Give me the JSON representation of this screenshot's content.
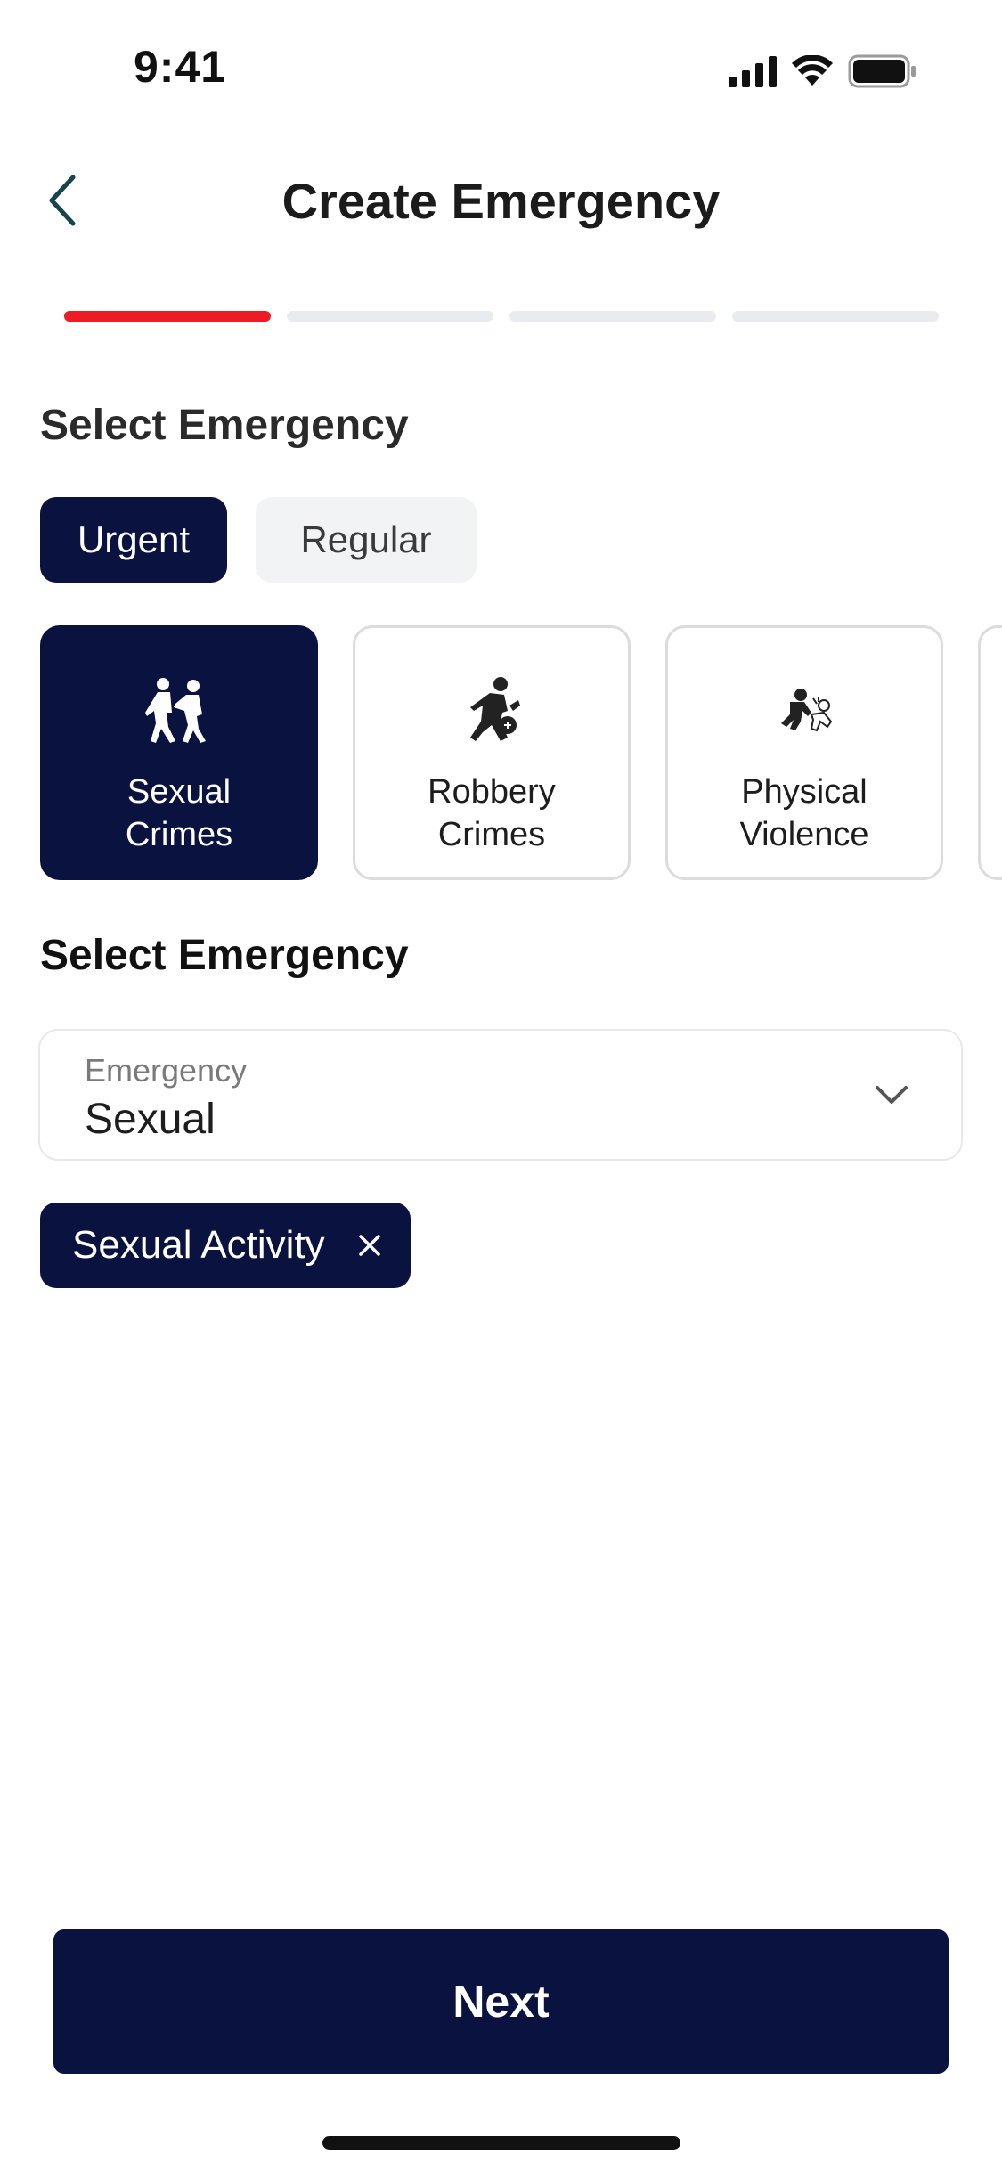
{
  "status_bar": {
    "time": "9:41",
    "signal_icon": "cellular-signal-icon",
    "wifi_icon": "wifi-icon",
    "battery_icon": "battery-icon"
  },
  "header": {
    "back_icon": "chevron-left-icon",
    "title": "Create Emergency"
  },
  "progress": {
    "total_steps": 4,
    "current_step": 1,
    "active_color": "#ee1b24",
    "inactive_color": "#e8ecef"
  },
  "section1": {
    "title": "Select Emergency"
  },
  "tabs": [
    {
      "label": "Urgent",
      "selected": true
    },
    {
      "label": "Regular",
      "selected": false
    }
  ],
  "categories": [
    {
      "label_line1": "Sexual",
      "label_line2": "Crimes",
      "icon": "sexual-crimes-icon",
      "selected": true
    },
    {
      "label_line1": "Robbery",
      "label_line2": "Crimes",
      "icon": "robbery-icon",
      "selected": false
    },
    {
      "label_line1": "Physical",
      "label_line2": "Violence",
      "icon": "physical-violence-icon",
      "selected": false
    },
    {
      "label_line1": "",
      "label_line2": "",
      "icon": "",
      "selected": false
    }
  ],
  "section2": {
    "title": "Select Emergency"
  },
  "dropdown": {
    "label": "Emergency",
    "value": "Sexual",
    "icon": "chevron-down-icon"
  },
  "chips": [
    {
      "label": "Sexual Activity",
      "icon": "close-icon"
    }
  ],
  "footer": {
    "next_label": "Next"
  },
  "colors": {
    "primary": "#0a1240",
    "accent": "#ee1b24"
  }
}
